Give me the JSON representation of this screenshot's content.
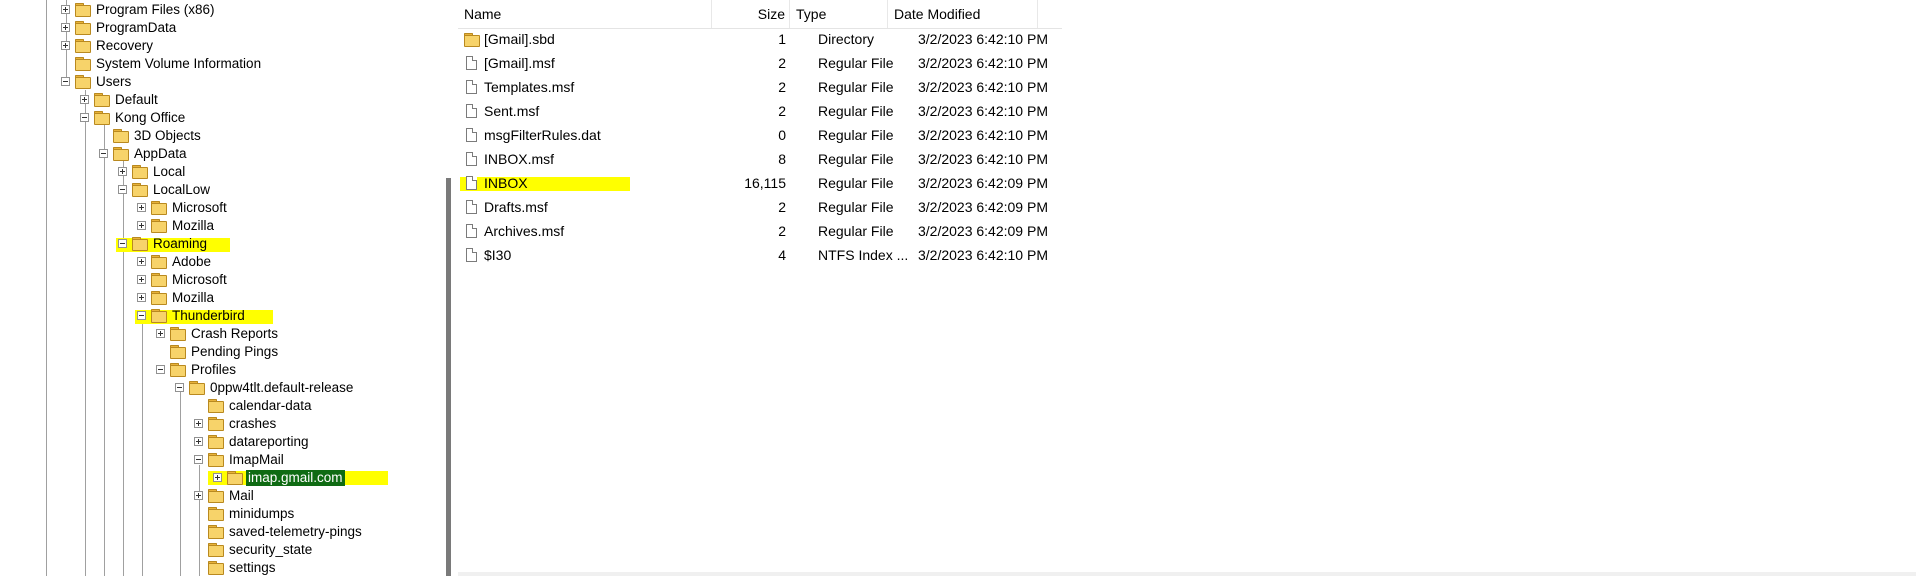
{
  "tree": {
    "nodes": [
      {
        "label": "Program Files (x86)"
      },
      {
        "label": "ProgramData"
      },
      {
        "label": "Recovery"
      },
      {
        "label": "System Volume Information"
      },
      {
        "label": "Users"
      },
      {
        "label": "Default"
      },
      {
        "label": "Kong Office"
      },
      {
        "label": "3D Objects"
      },
      {
        "label": "AppData"
      },
      {
        "label": "Local"
      },
      {
        "label": "LocalLow"
      },
      {
        "label": "Microsoft"
      },
      {
        "label": "Mozilla"
      },
      {
        "label": "Roaming"
      },
      {
        "label": "Adobe"
      },
      {
        "label": "Microsoft"
      },
      {
        "label": "Mozilla"
      },
      {
        "label": "Thunderbird"
      },
      {
        "label": "Crash Reports"
      },
      {
        "label": "Pending Pings"
      },
      {
        "label": "Profiles"
      },
      {
        "label": "0ppw4tlt.default-release"
      },
      {
        "label": "calendar-data"
      },
      {
        "label": "crashes"
      },
      {
        "label": "datareporting"
      },
      {
        "label": "ImapMail"
      },
      {
        "label": "imap.gmail.com"
      },
      {
        "label": "Mail"
      },
      {
        "label": "minidumps"
      },
      {
        "label": "saved-telemetry-pings"
      },
      {
        "label": "security_state"
      },
      {
        "label": "settings"
      }
    ]
  },
  "list": {
    "headers": {
      "name": "Name",
      "size": "Size",
      "type": "Type",
      "modified": "Date Modified"
    },
    "rows": [
      {
        "name": "[Gmail].sbd",
        "size": "1",
        "type": "Directory",
        "modified": "3/2/2023 6:42:10 PM",
        "icon": "folder-icon"
      },
      {
        "name": "[Gmail].msf",
        "size": "2",
        "type": "Regular File",
        "modified": "3/2/2023 6:42:10 PM",
        "icon": "file-icon"
      },
      {
        "name": "Templates.msf",
        "size": "2",
        "type": "Regular File",
        "modified": "3/2/2023 6:42:10 PM",
        "icon": "file-icon"
      },
      {
        "name": "Sent.msf",
        "size": "2",
        "type": "Regular File",
        "modified": "3/2/2023 6:42:10 PM",
        "icon": "file-icon"
      },
      {
        "name": "msgFilterRules.dat",
        "size": "0",
        "type": "Regular File",
        "modified": "3/2/2023 6:42:10 PM",
        "icon": "file-icon"
      },
      {
        "name": "INBOX.msf",
        "size": "8",
        "type": "Regular File",
        "modified": "3/2/2023 6:42:10 PM",
        "icon": "file-icon"
      },
      {
        "name": "INBOX",
        "size": "16,115",
        "type": "Regular File",
        "modified": "3/2/2023 6:42:09 PM",
        "icon": "file-icon"
      },
      {
        "name": "Drafts.msf",
        "size": "2",
        "type": "Regular File",
        "modified": "3/2/2023 6:42:09 PM",
        "icon": "file-icon"
      },
      {
        "name": "Archives.msf",
        "size": "2",
        "type": "Regular File",
        "modified": "3/2/2023 6:42:09 PM",
        "icon": "file-icon"
      },
      {
        "name": "$I30",
        "size": "4",
        "type": "NTFS Index ...",
        "modified": "3/2/2023 6:42:10 PM",
        "icon": "file-icon"
      }
    ]
  },
  "colors": {
    "highlight": "#ffff00",
    "selected": "#0f6b13",
    "folder": "#f7d36a"
  }
}
